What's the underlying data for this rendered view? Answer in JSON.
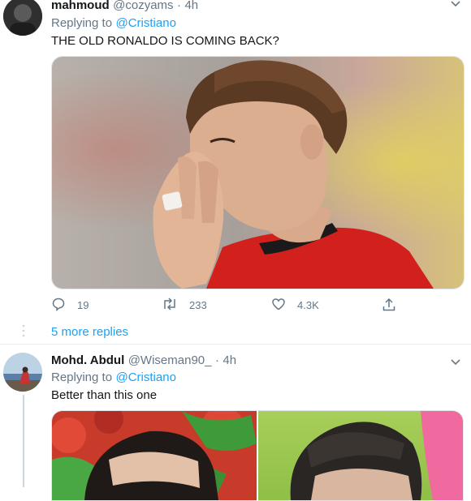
{
  "tweet1": {
    "display_name": "mahmoud",
    "handle": "@cozyams",
    "separator": "·",
    "time": "4h",
    "replying_label": "Replying to",
    "replying_to": "@Cristiano",
    "text": "THE OLD RONALDO IS COMING BACK?",
    "stats": {
      "replies": "19",
      "retweets": "233",
      "likes": "4.3K"
    }
  },
  "more_replies": "5 more replies",
  "tweet2": {
    "display_name": "Mohd. Abdul",
    "handle": "@Wiseman90_",
    "separator": "·",
    "time": "4h",
    "replying_label": "Replying to",
    "replying_to": "@Cristiano",
    "text": "Better than this one"
  },
  "colors": {
    "link": "#1da1f2",
    "muted": "#657786",
    "jersey_red": "#d2211c"
  }
}
